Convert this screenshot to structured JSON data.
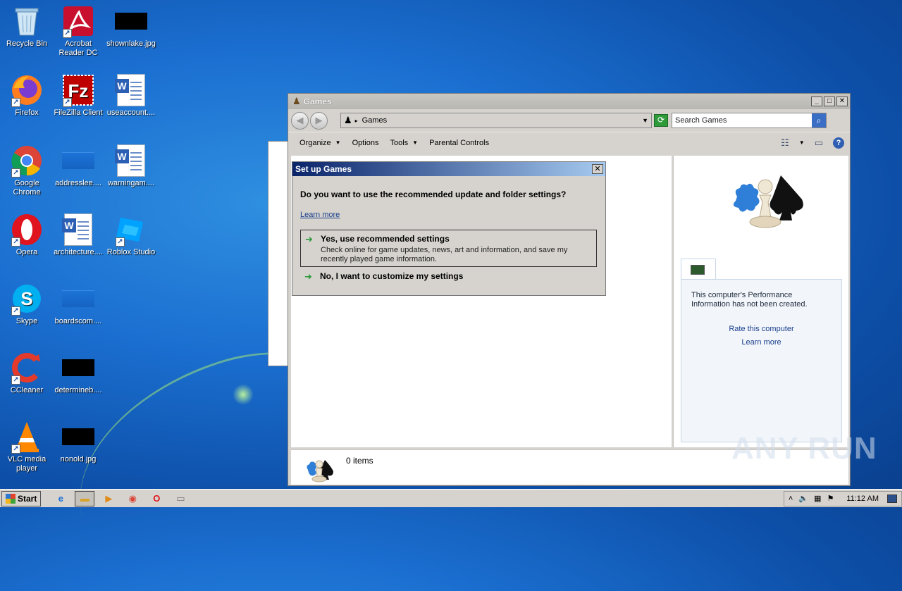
{
  "desktop": {
    "icons": [
      {
        "label": "Recycle Bin",
        "icon": "recycle-bin-icon"
      },
      {
        "label": "Acrobat Reader DC",
        "icon": "acrobat-icon"
      },
      {
        "label": "shownlake.jpg",
        "icon": "image-file-icon"
      },
      {
        "label": "Firefox",
        "icon": "firefox-icon"
      },
      {
        "label": "FileZilla Client",
        "icon": "filezilla-icon"
      },
      {
        "label": "useaccount....",
        "icon": "word-doc-icon"
      },
      {
        "label": "Google Chrome",
        "icon": "chrome-icon"
      },
      {
        "label": "addresslee....",
        "icon": "file-icon"
      },
      {
        "label": "warningam....",
        "icon": "word-doc-icon"
      },
      {
        "label": "Opera",
        "icon": "opera-icon"
      },
      {
        "label": "architecture....",
        "icon": "word-doc-icon"
      },
      {
        "label": "Roblox Studio",
        "icon": "roblox-icon"
      },
      {
        "label": "Skype",
        "icon": "skype-icon"
      },
      {
        "label": "boardscom....",
        "icon": "file-icon"
      },
      {
        "label": "CCleaner",
        "icon": "ccleaner-icon"
      },
      {
        "label": "determineb....",
        "icon": "image-file-icon"
      },
      {
        "label": "VLC media player",
        "icon": "vlc-icon"
      },
      {
        "label": "nonold.jpg",
        "icon": "image-file-icon"
      }
    ]
  },
  "window": {
    "title": "Games",
    "address": "Games",
    "search_placeholder": "Search Games",
    "toolbar": {
      "organize": "Organize",
      "options": "Options",
      "tools": "Tools",
      "parental": "Parental Controls"
    },
    "perf": {
      "message": "This computer's Performance Information has not been created.",
      "rate": "Rate this computer",
      "learn": "Learn more"
    },
    "status": "0 items"
  },
  "dialog": {
    "title": "Set up Games",
    "question": "Do you want to use the recommended update and folder settings?",
    "learn_more": "Learn more",
    "option1_title": "Yes, use recommended settings",
    "option1_desc": "Check online for game updates, news, art and information, and save my recently played game information.",
    "option2_title": "No, I want to customize my settings"
  },
  "taskbar": {
    "start": "Start",
    "clock": "11:12 AM"
  },
  "watermark": "ANY RUN",
  "colors": {
    "dialog_title_start": "#0a246a",
    "dialog_title_end": "#a6caf0",
    "link": "#1a3e8c",
    "desktop": "#1b6fd0"
  }
}
